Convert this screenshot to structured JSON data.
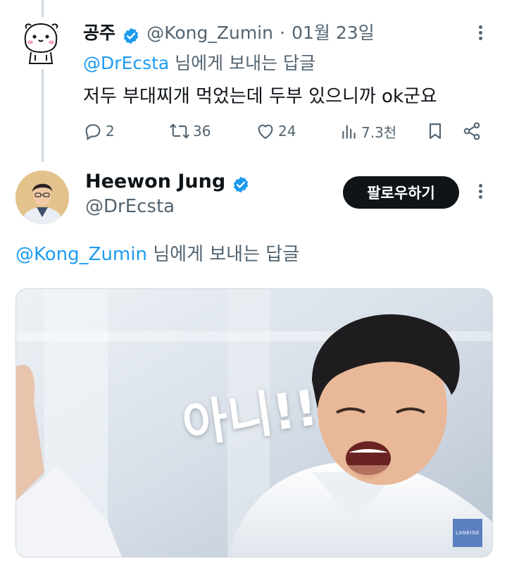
{
  "tweet1": {
    "display_name": "공주",
    "handle": "@Kong_Zumin",
    "separator": "·",
    "date": "01월 23일",
    "reply_mention": "@DrEcsta",
    "reply_suffix": " 님에게 보내는 답글",
    "text": "저두 부대찌개 먹었는데 두부 있으니까 ok군요",
    "actions": {
      "replies": "2",
      "retweets": "36",
      "likes": "24",
      "views": "7.3천"
    }
  },
  "tweet2": {
    "display_name": "Heewon Jung",
    "handle": "@DrEcsta",
    "follow_label": "팔로우하기",
    "reply_mention": "@Kong_Zumin",
    "reply_suffix": " 님에게 보내는 답글",
    "media": {
      "overlay_text": "아니!!",
      "watermark": "LANEIGE"
    }
  },
  "colors": {
    "link": "#1d9bf0",
    "text": "#0f1419",
    "muted": "#536471",
    "follow_bg": "#0f1419"
  }
}
